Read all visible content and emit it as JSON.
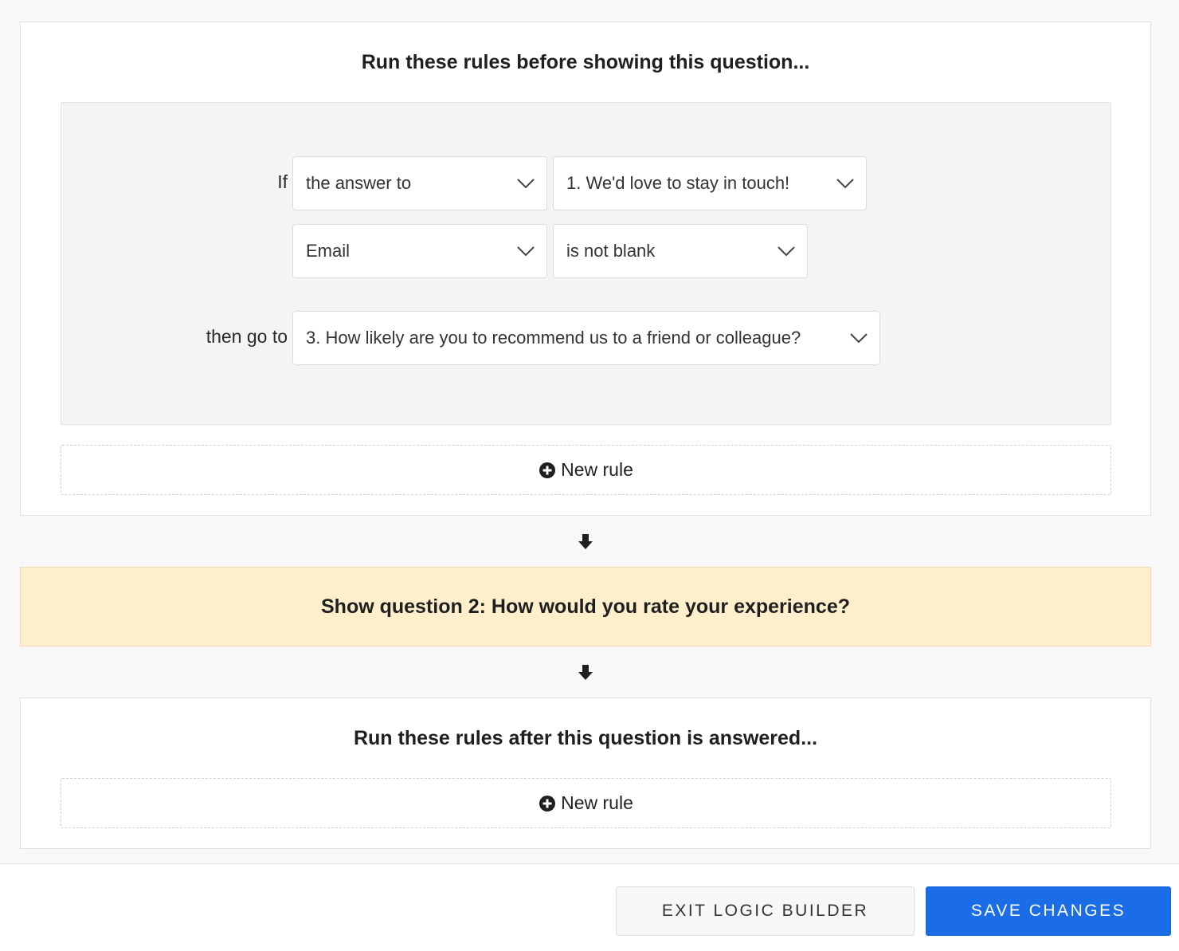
{
  "before_rules": {
    "title": "Run these rules before showing this question...",
    "rule": {
      "if_label": "If",
      "subject_select": "the answer to",
      "question_select": "1. We'd love to stay in touch!",
      "field_select": "Email",
      "operator_select": "is not blank",
      "then_label": "then go to",
      "target_select": "3. How likely are you to recommend us to a friend or colleague?"
    },
    "new_rule_label": "New rule"
  },
  "show_question": {
    "text": "Show question 2: How would you rate your experience?"
  },
  "after_rules": {
    "title": "Run these rules after this question is answered...",
    "new_rule_label": "New rule"
  },
  "footer": {
    "exit_label": "EXIT LOGIC BUILDER",
    "save_label": "SAVE CHANGES"
  },
  "icons": {
    "chevron": "chevron-down-icon",
    "plus": "plus-circle-icon",
    "arrow": "arrow-down-icon"
  },
  "colors": {
    "accent": "#1a6de6",
    "highlight": "#fdefcc",
    "rule_bg": "#f4f4f4"
  }
}
